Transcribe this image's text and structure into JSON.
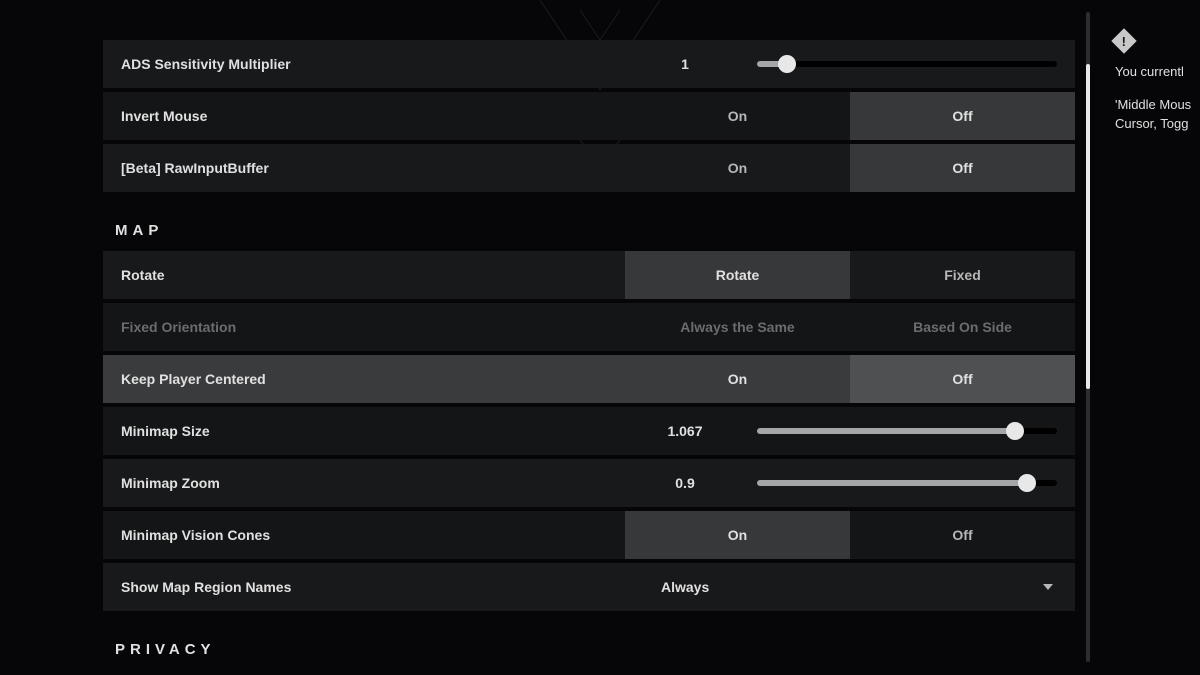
{
  "mouse_section": {
    "ads": {
      "label": "ADS Sensitivity Multiplier",
      "value": "1",
      "min": 0,
      "max": 10,
      "pos_pct": 10
    },
    "invert": {
      "label": "Invert Mouse",
      "on": "On",
      "off": "Off",
      "selected": "off"
    },
    "rawinput": {
      "label": "[Beta] RawInputBuffer",
      "on": "On",
      "off": "Off",
      "selected": "off"
    }
  },
  "map_header": "MAP",
  "map_section": {
    "rotate": {
      "label": "Rotate",
      "a": "Rotate",
      "b": "Fixed",
      "selected": "a"
    },
    "fixed_orient": {
      "label": "Fixed Orientation",
      "a": "Always the Same",
      "b": "Based On Side",
      "selected": "a",
      "disabled": true
    },
    "keep_center": {
      "label": "Keep Player Centered",
      "a": "On",
      "b": "Off",
      "selected": "b",
      "highlight": true
    },
    "mm_size": {
      "label": "Minimap Size",
      "value": "1.067",
      "pos_pct": 86
    },
    "mm_zoom": {
      "label": "Minimap Zoom",
      "value": "0.9",
      "pos_pct": 90
    },
    "vision": {
      "label": "Minimap Vision Cones",
      "a": "On",
      "b": "Off",
      "selected": "a"
    },
    "region": {
      "label": "Show Map Region Names",
      "value": "Always"
    }
  },
  "privacy_header": "PRIVACY",
  "info": {
    "line1": "You currentl",
    "line2": "'Middle Mous",
    "line3": "Cursor, Togg"
  },
  "scroll": {
    "thumb_top_pct": 8,
    "thumb_height_pct": 50
  }
}
